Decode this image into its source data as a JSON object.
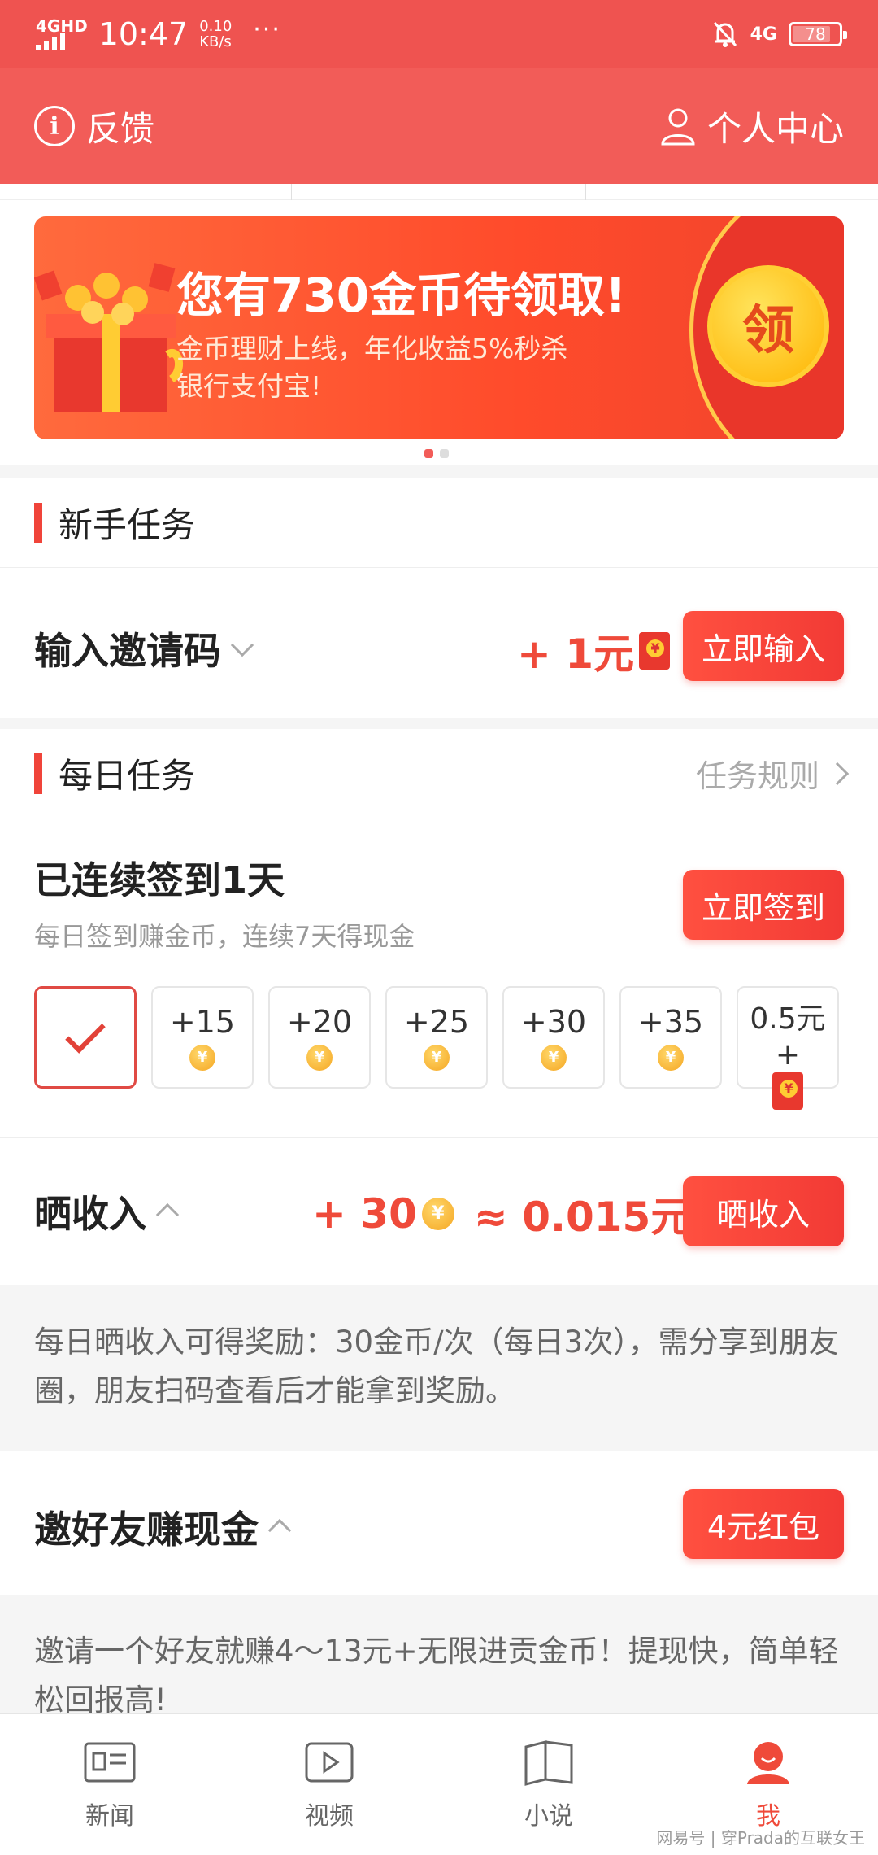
{
  "status_bar": {
    "network": "4GHD",
    "time": "10:47",
    "speed_value": "0.10",
    "speed_unit": "KB/s",
    "dots": "···",
    "network_right": "4G",
    "battery": "78"
  },
  "header": {
    "feedback_label": "反馈",
    "profile_label": "个人中心"
  },
  "banner": {
    "title": "您有730金币待领取!",
    "subtitle_line1": "金币理财上线，年化收益5%秒杀",
    "subtitle_line2": "银行支付宝!",
    "claim_label": "领",
    "slide_count": 2,
    "active_slide": 1
  },
  "newbie_section": {
    "title": "新手任务",
    "invite_code": {
      "label": "输入邀请码",
      "reward": "+ 1元",
      "button": "立即输入"
    }
  },
  "daily_section": {
    "title": "每日任务",
    "rules_link": "任务规则",
    "checkin": {
      "title": "已连续签到1天",
      "subtitle": "每日签到赚金币，连续7天得现金",
      "button": "立即签到",
      "days": [
        {
          "label": "",
          "done": true
        },
        {
          "label": "+15"
        },
        {
          "label": "+20"
        },
        {
          "label": "+25"
        },
        {
          "label": "+30"
        },
        {
          "label": "+35"
        },
        {
          "label_line1": "0.5元",
          "label_line2": "+"
        }
      ]
    },
    "share_income": {
      "label": "晒收入",
      "reward_coins": "+ 30",
      "reward_cash": "≈ 0.015元",
      "button": "晒收入",
      "description": "每日晒收入可得奖励：30金币/次（每日3次），需分享到朋友圈，朋友扫码查看后才能拿到奖励。"
    },
    "invite_friends": {
      "label": "邀好友赚现金",
      "button": "4元红包",
      "description": "邀请一个好友就赚4～13元+无限进贡金币！提现快，简单轻松回报高!"
    }
  },
  "bottom_nav": {
    "items": [
      {
        "label": "新闻",
        "icon": "news-icon"
      },
      {
        "label": "视频",
        "icon": "video-icon"
      },
      {
        "label": "小说",
        "icon": "book-icon"
      },
      {
        "label": "我",
        "icon": "me-icon",
        "active": true
      }
    ]
  },
  "watermark": "网易号 | 穿Prada的互联女王",
  "colors": {
    "primary_red": "#f25c58",
    "accent_red": "#ef4a3a",
    "coin_gold": "#f5a623"
  }
}
